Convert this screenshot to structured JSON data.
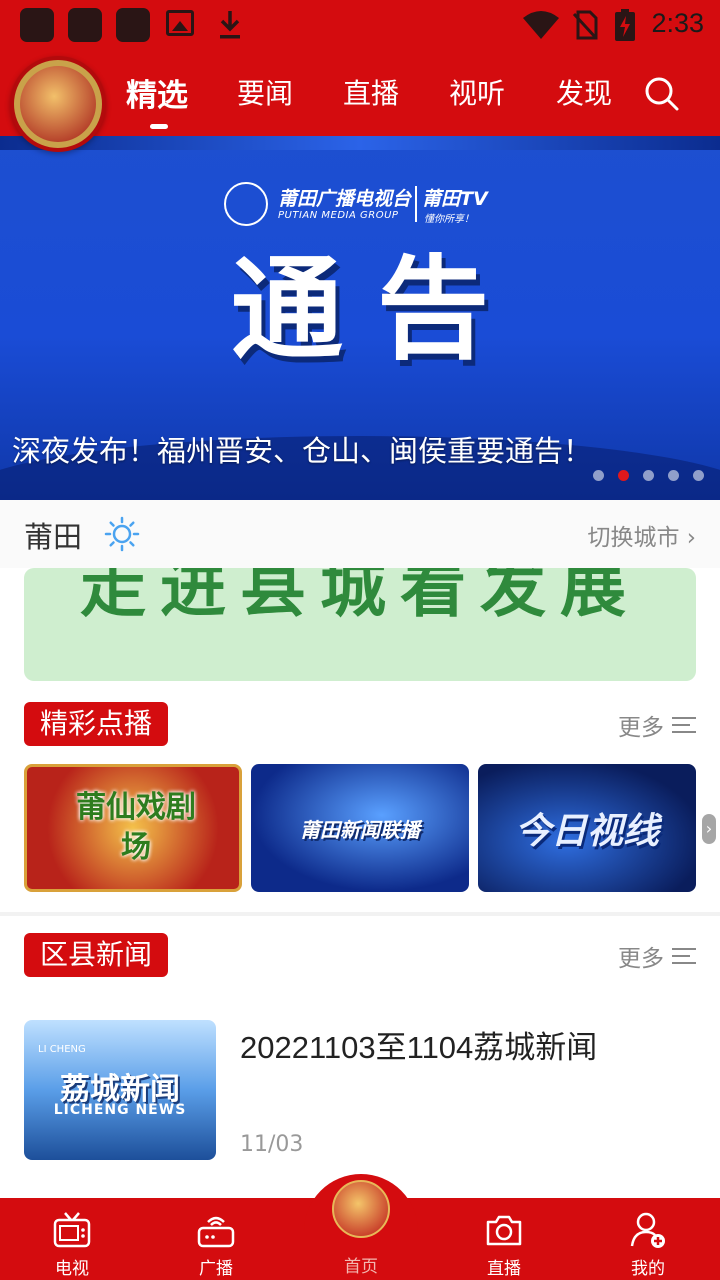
{
  "status_bar": {
    "time": "2:33"
  },
  "header": {
    "tabs": [
      {
        "label": "精选",
        "active": true
      },
      {
        "label": "要闻"
      },
      {
        "label": "直播"
      },
      {
        "label": "视听"
      },
      {
        "label": "发现"
      }
    ],
    "search_icon": "search-icon"
  },
  "banner": {
    "brand_cn": "莆田广播电视台",
    "brand_en": "PUTIAN MEDIA GROUP",
    "brand_tv": "莆田TV",
    "brand_slogan": "懂你所享！",
    "headline": "通告",
    "caption": "深夜发布！福州晋安、仓山、闽侯重要通告！",
    "slide_count": 5,
    "active_slide": 2
  },
  "weather": {
    "city": "莆田",
    "icon": "sun-icon",
    "switch_label": "切换城市"
  },
  "promo": {
    "text": "走进县城看发展"
  },
  "vod": {
    "title": "精彩点播",
    "more": "更多",
    "items": [
      {
        "label": "莆仙戏剧场"
      },
      {
        "label": "莆田新闻联播"
      },
      {
        "label": "今日视线"
      }
    ]
  },
  "district": {
    "title": "区县新闻",
    "more": "更多",
    "items": [
      {
        "title": "20221103至1104荔城新闻",
        "date": "11/03",
        "thumb_cn": "荔城新闻",
        "thumb_en": "LICHENG NEWS",
        "thumb_tag": "LI CHENG"
      }
    ]
  },
  "bottom_nav": {
    "items": [
      {
        "label": "电视",
        "icon": "tv-icon"
      },
      {
        "label": "广播",
        "icon": "radio-icon"
      },
      {
        "label": "首页",
        "icon": "home-logo-icon",
        "active": true
      },
      {
        "label": "直播",
        "icon": "camera-icon"
      },
      {
        "label": "我的",
        "icon": "user-add-icon"
      }
    ]
  },
  "colors": {
    "brand_red": "#d40c0f",
    "promo_green": "#2f8a3c",
    "banner_blue": "#1a4cd6"
  }
}
